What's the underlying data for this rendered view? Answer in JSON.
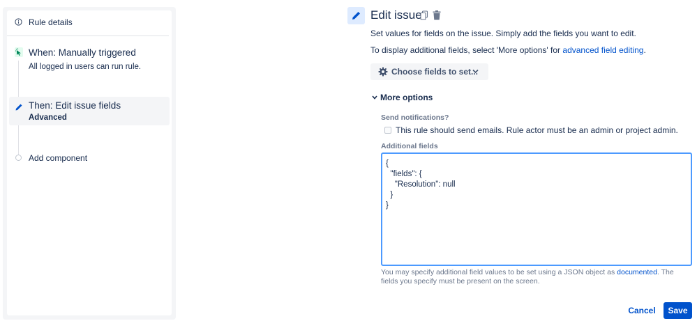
{
  "sidebar": {
    "rule_details": {
      "label": "Rule details",
      "icon": "info-icon"
    },
    "trigger": {
      "title": "When: Manually triggered",
      "subtitle": "All logged in users can run rule.",
      "icon": "cursor-click-icon"
    },
    "action": {
      "title": "Then: Edit issue fields",
      "subtitle": "Advanced",
      "icon": "pencil-icon"
    },
    "add_component": {
      "label": "Add component"
    }
  },
  "editor": {
    "title": "Edit issue",
    "description": "Set values for fields on the issue. Simply add the fields you want to edit.",
    "display_text_before": "To display additional fields, select 'More options' for ",
    "display_link": "advanced field editing",
    "display_text_after": ".",
    "choose_fields_label": "Choose fields to set...",
    "more_options_label": "More options",
    "send_notifications_label": "Send notifications?",
    "checkbox_label": "This rule should send emails. Rule actor must be an admin or project admin.",
    "checkbox_checked": false,
    "additional_fields_label": "Additional fields",
    "additional_fields_value": "{\n  \"fields\": {\n    \"Resolution\": null\n  }\n}",
    "help_text_before": "You may specify additional field values to be set using a JSON object as ",
    "help_link": "documented",
    "help_text_after": ". The fields you specify must be present on the screen.",
    "cancel_label": "Cancel",
    "save_label": "Save"
  },
  "colors": {
    "accent": "#0052cc",
    "focus_border": "#4c9aff",
    "trigger_bg": "#e3fcef",
    "trigger_icon": "#00875a",
    "selected_bg": "#f4f5f7"
  }
}
